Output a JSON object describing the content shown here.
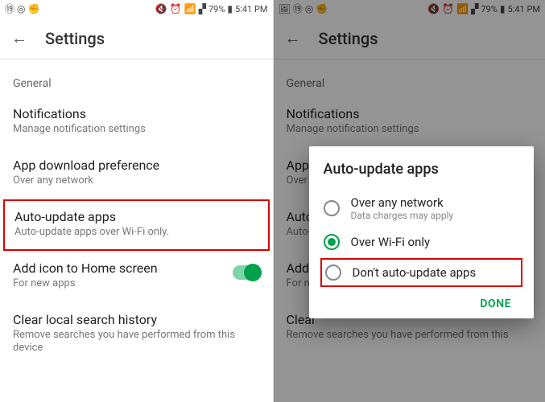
{
  "statusbar": {
    "battery_pct": "79%",
    "time": "5:41 PM"
  },
  "header": {
    "title": "Settings"
  },
  "section_general": "General",
  "items": {
    "notifications": {
      "title": "Notifications",
      "sub": "Manage notification settings"
    },
    "download_pref": {
      "title": "App download preference",
      "sub": "Over any network"
    },
    "auto_update": {
      "title": "Auto-update apps",
      "sub": "Auto-update apps over Wi-Fi only."
    },
    "add_icon": {
      "title": "Add icon to Home screen",
      "sub": "For new apps"
    },
    "clear_history": {
      "title": "Clear local search history",
      "sub": "Remove searches you have performed from this device"
    }
  },
  "right_items": {
    "notifications": {
      "title": "Notifications",
      "sub": "Manage notification settings"
    },
    "download_pref": {
      "title": "App d",
      "sub": "Over a"
    },
    "auto_update": {
      "title": "Auto-",
      "sub": "Auto-"
    },
    "add_icon": {
      "title": "Add i",
      "sub": "For ne"
    },
    "clear_history": {
      "title": "Clear",
      "sub": "Remove searches you have performed from this"
    }
  },
  "dialog": {
    "title": "Auto-update apps",
    "options": {
      "any": {
        "label": "Over any network",
        "sub": "Data charges may apply"
      },
      "wifi": {
        "label": "Over Wi-Fi only"
      },
      "none": {
        "label": "Don't auto-update apps"
      }
    },
    "done": "DONE"
  }
}
